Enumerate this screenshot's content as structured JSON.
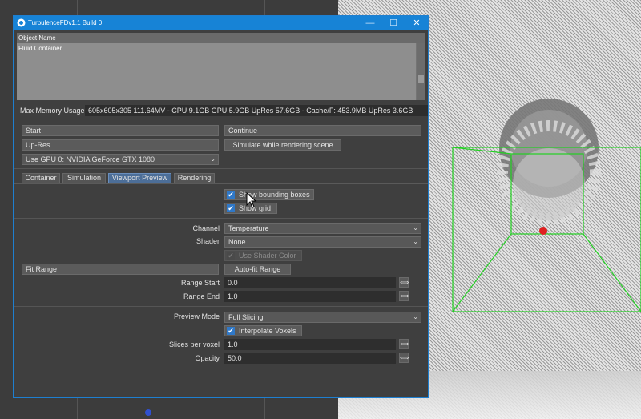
{
  "window": {
    "title": "TurbulenceFDv1.1 Build 0",
    "minimize": "—",
    "maximize": "☐",
    "close": "✕"
  },
  "objects": {
    "header": "Object Name",
    "items": [
      "Fluid Container"
    ]
  },
  "memory": {
    "label": "Max Memory Usage",
    "value": "605x605x305 111.64MV - CPU 9.1GB GPU 5.9GB UpRes 57.6GB - Cache/F: 453.9MB UpRes 3.6GB"
  },
  "buttons": {
    "start": "Start",
    "continue": "Continue",
    "upres": "Up-Res",
    "simulate_while_rendering": "Simulate while rendering scene",
    "gpu_select": "Use GPU 0: NVIDIA GeForce GTX 1080"
  },
  "tabs": [
    {
      "label": "Container",
      "active": false
    },
    {
      "label": "Simulation",
      "active": false
    },
    {
      "label": "Viewport Preview",
      "active": true
    },
    {
      "label": "Rendering",
      "active": false
    }
  ],
  "preview": {
    "show_bounding_boxes": {
      "label": "Show bounding boxes",
      "checked": true
    },
    "show_grid": {
      "label": "Show grid",
      "checked": true
    },
    "channel": {
      "label": "Channel",
      "value": "Temperature"
    },
    "shader": {
      "label": "Shader",
      "value": "None"
    },
    "use_shader_color": {
      "label": "Use Shader Color",
      "checked": true,
      "enabled": false
    },
    "fit_range": "Fit Range",
    "auto_fit_range": "Auto-fit Range",
    "range_start": {
      "label": "Range Start",
      "value": "0.0"
    },
    "range_end": {
      "label": "Range End",
      "value": "1.0"
    },
    "preview_mode": {
      "label": "Preview Mode",
      "value": "Full Slicing"
    },
    "interpolate_voxels": {
      "label": "Interpolate Voxels",
      "checked": true
    },
    "slices_per_voxel": {
      "label": "Slices per voxel",
      "value": "1.0"
    },
    "opacity": {
      "label": "Opacity",
      "value": "50.0"
    }
  },
  "icons": {
    "checkmark": "✔",
    "dropdown": "⌄",
    "spinner": "⟺"
  },
  "colors": {
    "titlebar": "#1783d6",
    "active_tab": "#4c6e98",
    "checkbox": "#2f78c8",
    "bbox_green": "#22d022",
    "emitter_red": "#e02020"
  }
}
